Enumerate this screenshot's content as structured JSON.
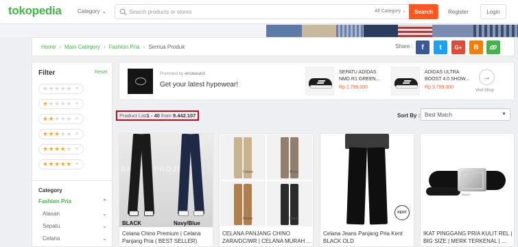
{
  "header": {
    "logo": "tokopedia",
    "category_label": "Category",
    "search_placeholder": "Search products or stores",
    "search_category": "All Category",
    "search_button": "Search",
    "register": "Register",
    "login": "Login"
  },
  "breadcrumb": {
    "items": [
      "Home",
      "Main Category",
      "Fashion Pria"
    ],
    "current": "Semua Produk"
  },
  "share": {
    "label": "Share :",
    "buttons": [
      {
        "name": "facebook",
        "glyph": "f"
      },
      {
        "name": "twitter",
        "glyph": "t"
      },
      {
        "name": "google-plus",
        "glyph": "G+"
      },
      {
        "name": "blogger",
        "glyph": "B"
      },
      {
        "name": "copy-link",
        "glyph": "🔗"
      }
    ]
  },
  "filter": {
    "title": "Filter",
    "reset": "Reset",
    "rating_filled": [
      0,
      1,
      2,
      3,
      4,
      5
    ],
    "category_title": "Category",
    "categories": [
      {
        "label": "Fashion Pria",
        "type": "main"
      },
      {
        "label": "Atasan",
        "type": "sub"
      },
      {
        "label": "Sepatu",
        "type": "sub"
      },
      {
        "label": "Celana",
        "type": "sub"
      }
    ]
  },
  "promo": {
    "promoted_by": "Promoted by",
    "shop_name": "wristwearid",
    "tagline": "Get your latest hypewear!",
    "products": [
      {
        "name": "SEPATU ADIDAS NMD R1 GREEN...",
        "price": "Rp 2.799.000"
      },
      {
        "name": "ADIDAS ULTRA BOOST 4.0 SHOW...",
        "price": "Rp 3.799.000"
      }
    ],
    "visit": "Visit Shop"
  },
  "product_list": {
    "label_prefix": "Product List ",
    "range": "1 - 40",
    "from": " from ",
    "total": "9.442.107",
    "sort_label": "Sort By :",
    "sort_value": "Best Match"
  },
  "products": [
    {
      "title": "Celana Chino Premium | Celana Panjang Pria ( BEST SELLER)",
      "image_watermark": "BRAVO PROJECT",
      "image_labels": [
        "BLACK",
        "Navy/Blue Black"
      ]
    },
    {
      "title": "CELANA PANJANG CHINO ZARA/DC/WR | CELANA MURAH ...",
      "image_labels": [
        "Cream",
        "Moca",
        "Brown",
        "Khaki",
        "Mocca",
        "Black"
      ]
    },
    {
      "title": "Celana Jeans Panjang Pria Kent BLACK OLD",
      "image_labels": [
        "KENT"
      ]
    },
    {
      "title": "IKAT PINGGANG PRIA KULIT REL | BIG SIZE | MERK TERKENAL | ...",
      "image_labels": [
        "RIANO"
      ]
    }
  ],
  "colors": {
    "brand_green": "#42b549",
    "accent_orange": "#ff5722",
    "highlight_red": "#d0021b",
    "star": "#f5a623"
  }
}
